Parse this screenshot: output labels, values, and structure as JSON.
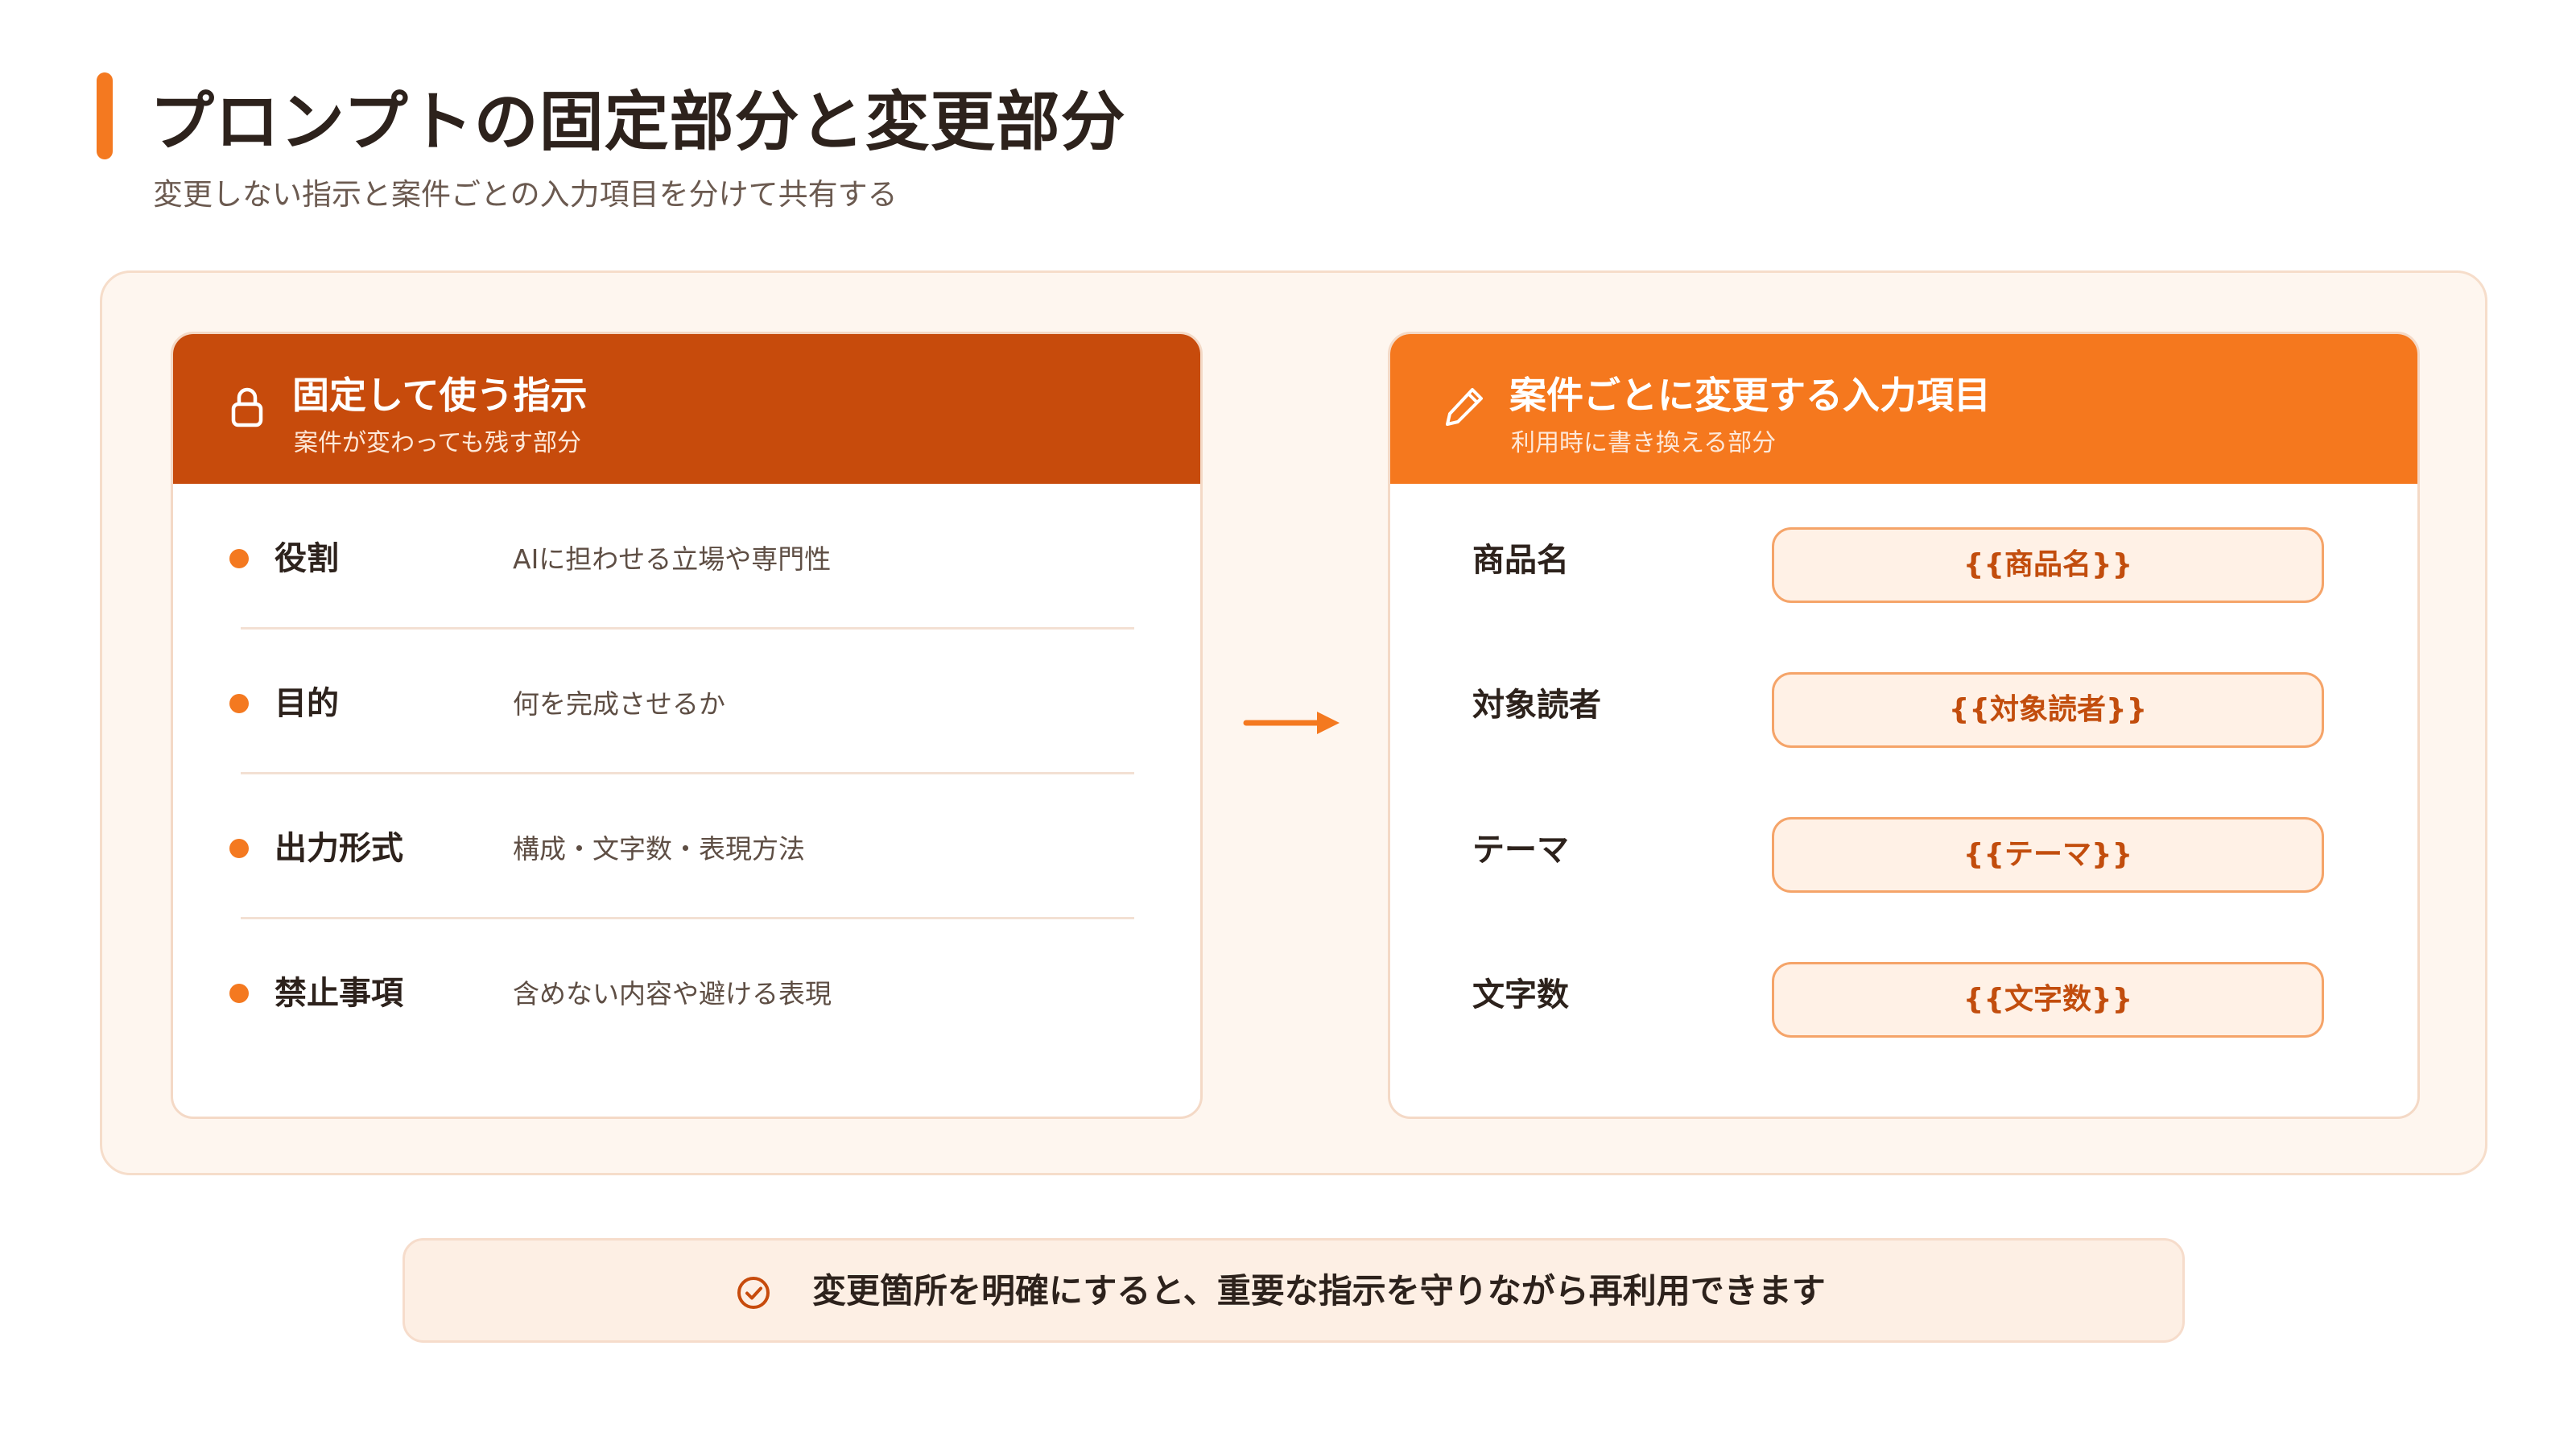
{
  "header": {
    "title": "プロンプトの固定部分と変更部分",
    "subtitle": "変更しない指示と案件ごとの入力項目を分けて共有する"
  },
  "colors": {
    "accent": "#f47920",
    "fixed_header": "#c74b0c",
    "variable_header": "#f5781e",
    "panel_bg": "#fef6ef",
    "placeholder_text": "#c24d0d"
  },
  "fixed_card": {
    "icon": "lock-icon",
    "title": "固定して使う指示",
    "subtitle": "案件が変わっても残す部分",
    "items": [
      {
        "label": "役割",
        "desc": "AIに担わせる立場や専門性"
      },
      {
        "label": "目的",
        "desc": "何を完成させるか"
      },
      {
        "label": "出力形式",
        "desc": "構成・文字数・表現方法"
      },
      {
        "label": "禁止事項",
        "desc": "含めない内容や避ける表現"
      }
    ]
  },
  "flow": {
    "icon": "arrow-right-icon"
  },
  "variable_card": {
    "icon": "pencil-icon",
    "title": "案件ごとに変更する入力項目",
    "subtitle": "利用時に書き換える部分",
    "items": [
      {
        "label": "商品名",
        "placeholder": "{{商品名}}"
      },
      {
        "label": "対象読者",
        "placeholder": "{{対象読者}}"
      },
      {
        "label": "テーマ",
        "placeholder": "{{テーマ}}"
      },
      {
        "label": "文字数",
        "placeholder": "{{文字数}}"
      }
    ]
  },
  "footer": {
    "icon": "check-circle-icon",
    "text": "変更箇所を明確にすると、重要な指示を守りながら再利用できます"
  }
}
